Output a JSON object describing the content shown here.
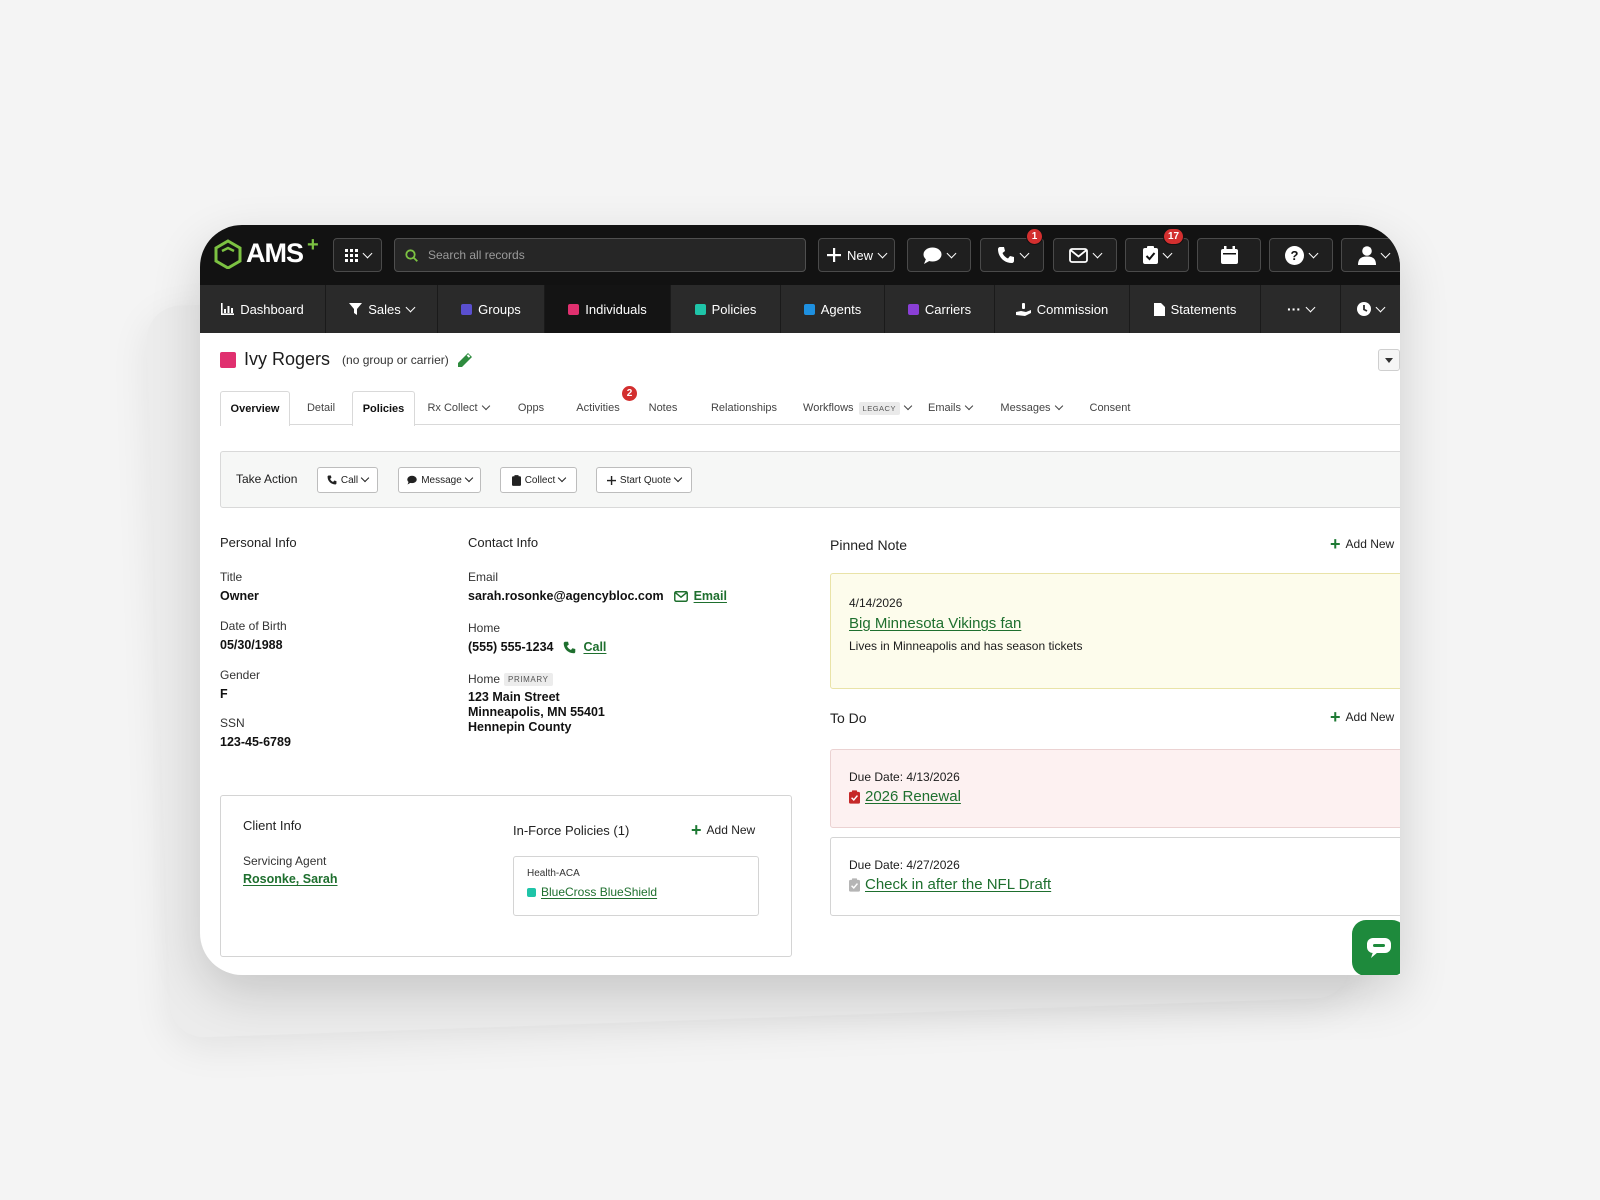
{
  "colors": {
    "brand_green": "#7cc242",
    "link_green": "#1e6f2e",
    "individuals": "#e0306f",
    "groups": "#5a4fcf",
    "policies": "#1fc4a8",
    "agents": "#1e90e0",
    "carriers": "#8a3fd6",
    "badge_red": "#d32f2f"
  },
  "topbar": {
    "logo": "AMS",
    "logo_plus": "+",
    "search_placeholder": "Search all records",
    "new_label": "New",
    "phone_badge": "1",
    "tasks_badge": "17",
    "icons": [
      "apps-grid-icon",
      "search-icon",
      "plus-icon",
      "chat-bubble-icon",
      "phone-icon",
      "envelope-icon",
      "clipboard-check-icon",
      "calendar-icon",
      "help-icon",
      "user-icon"
    ]
  },
  "nav": [
    {
      "label": "Dashboard",
      "icon": "chart-icon"
    },
    {
      "label": "Sales",
      "icon": "filter-icon"
    },
    {
      "label": "Groups",
      "icon": "groups-square"
    },
    {
      "label": "Individuals",
      "icon": "individuals-square"
    },
    {
      "label": "Policies",
      "icon": "policies-square"
    },
    {
      "label": "Agents",
      "icon": "agents-square"
    },
    {
      "label": "Carriers",
      "icon": "carriers-square"
    },
    {
      "label": "Commission",
      "icon": "hand-money-icon"
    },
    {
      "label": "Statements",
      "icon": "document-icon"
    },
    {
      "label": "···",
      "icon": "more-icon"
    },
    {
      "label": "",
      "icon": "clock-icon"
    }
  ],
  "record": {
    "name": "Ivy Rogers",
    "subtitle": "(no group or carrier)"
  },
  "tabs": [
    {
      "label": "Overview"
    },
    {
      "label": "Detail"
    },
    {
      "label": "Policies"
    },
    {
      "label": "Rx Collect"
    },
    {
      "label": "Opps"
    },
    {
      "label": "Activities",
      "badge": "2"
    },
    {
      "label": "Notes"
    },
    {
      "label": "Relationships"
    },
    {
      "label": "Workflows",
      "tag": "LEGACY"
    },
    {
      "label": "Emails"
    },
    {
      "label": "Messages"
    },
    {
      "label": "Consent"
    }
  ],
  "take_action": {
    "label": "Take Action",
    "buttons": [
      "Call",
      "Message",
      "Collect",
      "Start Quote"
    ]
  },
  "personal_info": {
    "heading": "Personal Info",
    "fields": [
      {
        "label": "Title",
        "value": "Owner"
      },
      {
        "label": "Date of Birth",
        "value": "05/30/1988"
      },
      {
        "label": "Gender",
        "value": "F"
      },
      {
        "label": "SSN",
        "value": "123-45-6789"
      }
    ]
  },
  "contact_info": {
    "heading": "Contact Info",
    "email_label": "Email",
    "email": "sarah.rosonke@agencybloc.com",
    "email_action": "Email",
    "home_label": "Home",
    "phone": "(555) 555-1234",
    "call_action": "Call",
    "address_label": "Home",
    "address_tag": "PRIMARY",
    "address_line1": "123 Main Street",
    "address_line2": "Minneapolis, MN 55401",
    "address_line3": "Hennepin County"
  },
  "client_info": {
    "heading": "Client Info",
    "agent_label": "Servicing Agent",
    "agent_name": "Rosonke, Sarah",
    "policies_heading": "In-Force Policies (1)",
    "add_new": "Add New",
    "policy_type": "Health-ACA",
    "policy_carrier": "BlueCross BlueShield"
  },
  "pinned_note": {
    "heading": "Pinned Note",
    "add_new": "Add New",
    "date": "4/14/2026",
    "title": "Big Minnesota Vikings fan",
    "body": "Lives in Minneapolis and has season tickets"
  },
  "todo": {
    "heading": "To Do",
    "add_new": "Add New",
    "items": [
      {
        "due": "Due Date: 4/13/2026",
        "title": "2026 Renewal"
      },
      {
        "due": "Due Date: 4/27/2026",
        "title": "Check in after the NFL Draft"
      }
    ]
  }
}
